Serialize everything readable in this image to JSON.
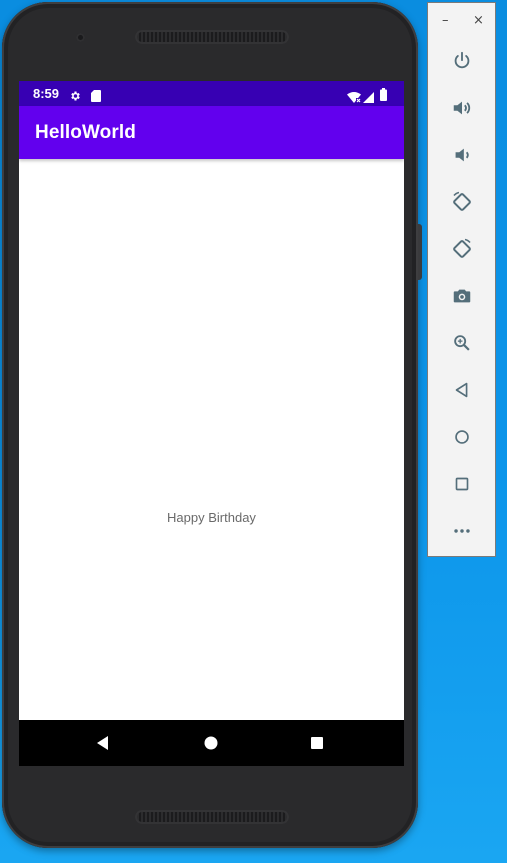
{
  "status_bar": {
    "time": "8:59",
    "icons": [
      "gear-icon",
      "sd-card-icon",
      "wifi-icon",
      "signal-icon",
      "battery-icon"
    ]
  },
  "app_bar": {
    "title": "HelloWorld"
  },
  "content": {
    "greeting": "Happy Birthday"
  },
  "nav_bar": {
    "buttons": [
      "back-icon",
      "home-icon",
      "recents-icon"
    ]
  },
  "emulator_toolbar": {
    "window_controls": {
      "minimize": "–",
      "close": "×"
    },
    "buttons": [
      "power-icon",
      "volume-up-icon",
      "volume-down-icon",
      "rotate-left-icon",
      "rotate-right-icon",
      "camera-icon",
      "zoom-icon",
      "back-icon",
      "home-icon",
      "overview-icon",
      "more-icon"
    ]
  },
  "colors": {
    "status_bar": "#3700b3",
    "app_bar": "#6200ee",
    "screen_bg": "#ffffff",
    "desktop": "#0c95ea",
    "toolbar_icons": "#546e7a"
  }
}
